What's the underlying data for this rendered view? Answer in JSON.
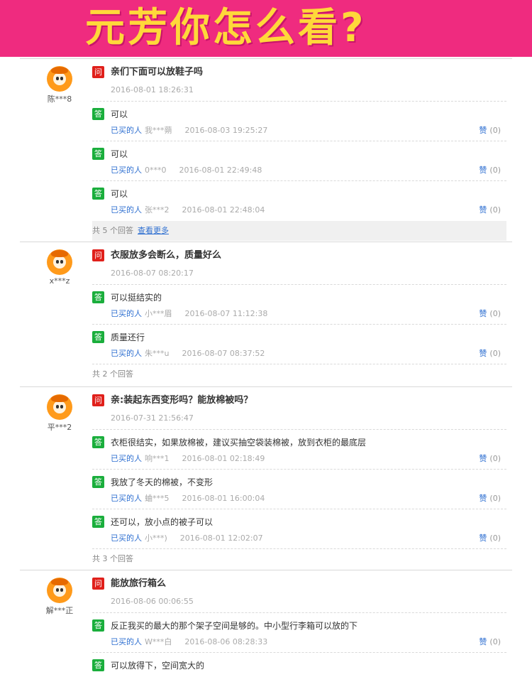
{
  "banner": {
    "title": "元芳你怎么看?"
  },
  "labels": {
    "q_tag": "问",
    "a_tag": "答",
    "buyer": "已买的人",
    "like": "赞",
    "more": "查看更多"
  },
  "threads": [
    {
      "user": "陈***8",
      "question": "亲们下面可以放鞋子吗",
      "date": "2016-08-01 18:26:31",
      "answers": [
        {
          "text": "可以",
          "nick": "我***蒴",
          "date": "2016-08-03 19:25:27",
          "likes": "(0)"
        },
        {
          "text": "可以",
          "nick": "0***0",
          "date": "2016-08-01 22:49:48",
          "likes": "(0)"
        },
        {
          "text": "可以",
          "nick": "张***2",
          "date": "2016-08-01 22:48:04",
          "likes": "(0)"
        }
      ],
      "total": "共 5 个回答"
    },
    {
      "user": "x***z",
      "question": "衣服放多会断么，质量好么",
      "date": "2016-08-07 08:20:17",
      "answers": [
        {
          "text": "可以挺结实的",
          "nick": "小***眉",
          "date": "2016-08-07 11:12:38",
          "likes": "(0)"
        },
        {
          "text": "质量还行",
          "nick": "朱***u",
          "date": "2016-08-07 08:37:52",
          "likes": "(0)"
        }
      ],
      "total": "共 2 个回答"
    },
    {
      "user": "平***2",
      "question": "亲:装起东西变形吗？能放棉被吗？",
      "date": "2016-07-31 21:56:47",
      "answers": [
        {
          "text": "衣柜很结实，如果放棉被，建议买抽空袋装棉被，放到衣柜的最底层",
          "nick": "响***1",
          "date": "2016-08-01 02:18:49",
          "likes": "(0)"
        },
        {
          "text": "我放了冬天的棉被，不变形",
          "nick": "蛐***5",
          "date": "2016-08-01 16:00:04",
          "likes": "(0)"
        },
        {
          "text": "还可以，放小点的被子可以",
          "nick": "小***)",
          "date": "2016-08-01 12:02:07",
          "likes": "(0)"
        }
      ],
      "total": "共 3 个回答"
    },
    {
      "user": "解***正",
      "question": "能放旅行箱么",
      "date": "2016-08-06 00:06:55",
      "answers": [
        {
          "text": "反正我买的最大的那个架子空间是够的。中小型行李箱可以放的下",
          "nick": "W***白",
          "date": "2016-08-06 08:28:33",
          "likes": "(0)"
        },
        {
          "text": "可以放得下，空间宽大的",
          "nick": "",
          "date": "",
          "likes": ""
        }
      ],
      "total": ""
    }
  ]
}
